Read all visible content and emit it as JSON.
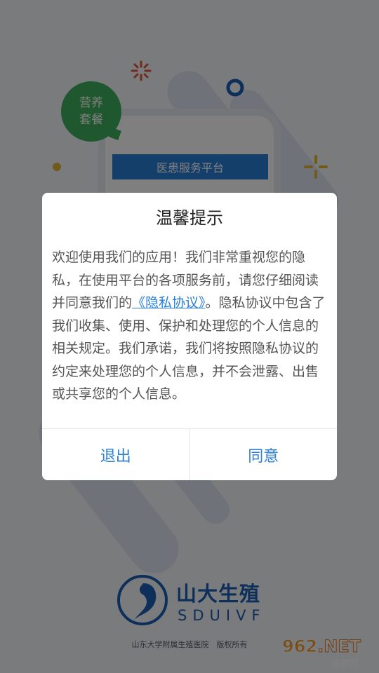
{
  "splash": {
    "nutrition_line1": "营养",
    "nutrition_line2": "套餐",
    "platform_label": "医患服务平台",
    "brand_cn": "山大生殖",
    "brand_en": "SDUIVF",
    "copyright": "山东大学附属生殖医院　版权所有"
  },
  "watermark": {
    "prefix": "",
    "number": "962",
    "suffix": ".NET",
    "caption": "乐游网"
  },
  "dialog": {
    "title": "温馨提示",
    "body_before": "欢迎使用我们的应用！我们非常重视您的隐私，在使用平台的各项服务前，请您仔细阅读并同意我们的",
    "privacy_link": "《隐私协议》",
    "body_after": "。隐私协议中包含了我们收集、使用、保护和处理您的个人信息的相关规定。我们承诺，我们将按照隐私协议的约定来处理您的个人信息，并不会泄露、出售或共享您的个人信息。",
    "exit_label": "退出",
    "agree_label": "同意"
  },
  "colors": {
    "accent": "#2a7fd6",
    "brand": "#1d5fb3",
    "bubble_green": "#3fae5c"
  }
}
